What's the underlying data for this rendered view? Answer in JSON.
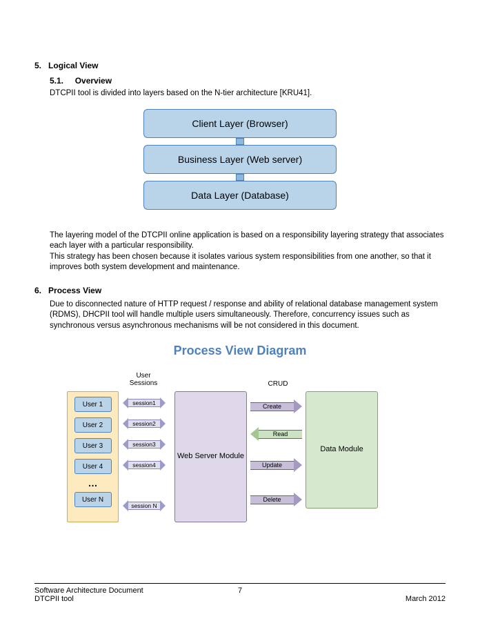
{
  "section5": {
    "number": "5.",
    "title": "Logical View",
    "sub_number": "5.1.",
    "sub_title": "Overview",
    "intro": "DTCPII tool is divided into layers based on the N-tier architecture [KRU41].",
    "layers": [
      "Client Layer (Browser)",
      "Business Layer (Web server)",
      "Data Layer (Database)"
    ],
    "para1": "The layering model of the DTCPII online application is based on a responsibility layering strategy that associates each layer with a particular responsibility.",
    "para2": "This strategy has been chosen because it isolates various system responsibilities from one another, so that it improves both system development and maintenance."
  },
  "section6": {
    "number": "6.",
    "title": "Process View",
    "body": "Due to disconnected nature of HTTP request / response and ability of relational database management system (RDMS), DHCPII tool will handle multiple users simultaneously. Therefore, concurrency issues such as synchronous versus asynchronous mechanisms will be not considered in this document.",
    "diagram_title": "Process View Diagram",
    "label_sessions": "User Sessions",
    "label_crud": "CRUD",
    "users": [
      "User 1",
      "User 2",
      "User 3",
      "User 4",
      "User N"
    ],
    "dots": "…",
    "sessions": [
      "session1",
      "session2",
      "session3",
      "session4",
      "session N"
    ],
    "web_server": "Web Server Module",
    "crud_ops": [
      "Create",
      "Read",
      "Update",
      "Delete"
    ],
    "data_module": "Data Module"
  },
  "footer": {
    "left1": "Software Architecture Document",
    "left2": "DTCPII tool",
    "center": "7",
    "right": "March 2012"
  }
}
